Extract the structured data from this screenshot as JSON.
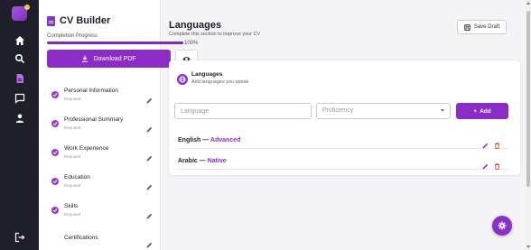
{
  "app": {
    "title": "CV Builder",
    "progress_label": "Completion Progress",
    "progress_value": 100,
    "progress_text": "100%",
    "download_label": "Download PDF",
    "accent": "#8b2cc6"
  },
  "rail": {
    "items": [
      {
        "icon": "home-icon",
        "active": false
      },
      {
        "icon": "search-icon",
        "active": false
      },
      {
        "icon": "document-icon",
        "active": true
      },
      {
        "icon": "chat-icon",
        "active": false
      },
      {
        "icon": "user-icon",
        "active": false
      }
    ],
    "logout_icon": "logout-icon"
  },
  "sections": [
    {
      "name": "Personal Information",
      "status": "Required",
      "done": true
    },
    {
      "name": "Professional Summary",
      "status": "Required",
      "done": true
    },
    {
      "name": "Work Experience",
      "status": "Required",
      "done": true
    },
    {
      "name": "Education",
      "status": "Required",
      "done": true
    },
    {
      "name": "Skills",
      "status": "Required",
      "done": true
    },
    {
      "name": "Certifications",
      "status": "",
      "done": false
    }
  ],
  "main": {
    "title": "Languages",
    "subtitle": "Complete this section to improve your CV",
    "save_label": "Save Draft"
  },
  "card": {
    "title": "Languages",
    "subtitle": "Add languages you speak",
    "language_placeholder": "Language",
    "proficiency_placeholder": "Proficiency",
    "add_label": "Add"
  },
  "languages": [
    {
      "name": "English",
      "separator": " — ",
      "level": "Advanced"
    },
    {
      "name": "Arabic",
      "separator": " — ",
      "level": "Native"
    }
  ]
}
